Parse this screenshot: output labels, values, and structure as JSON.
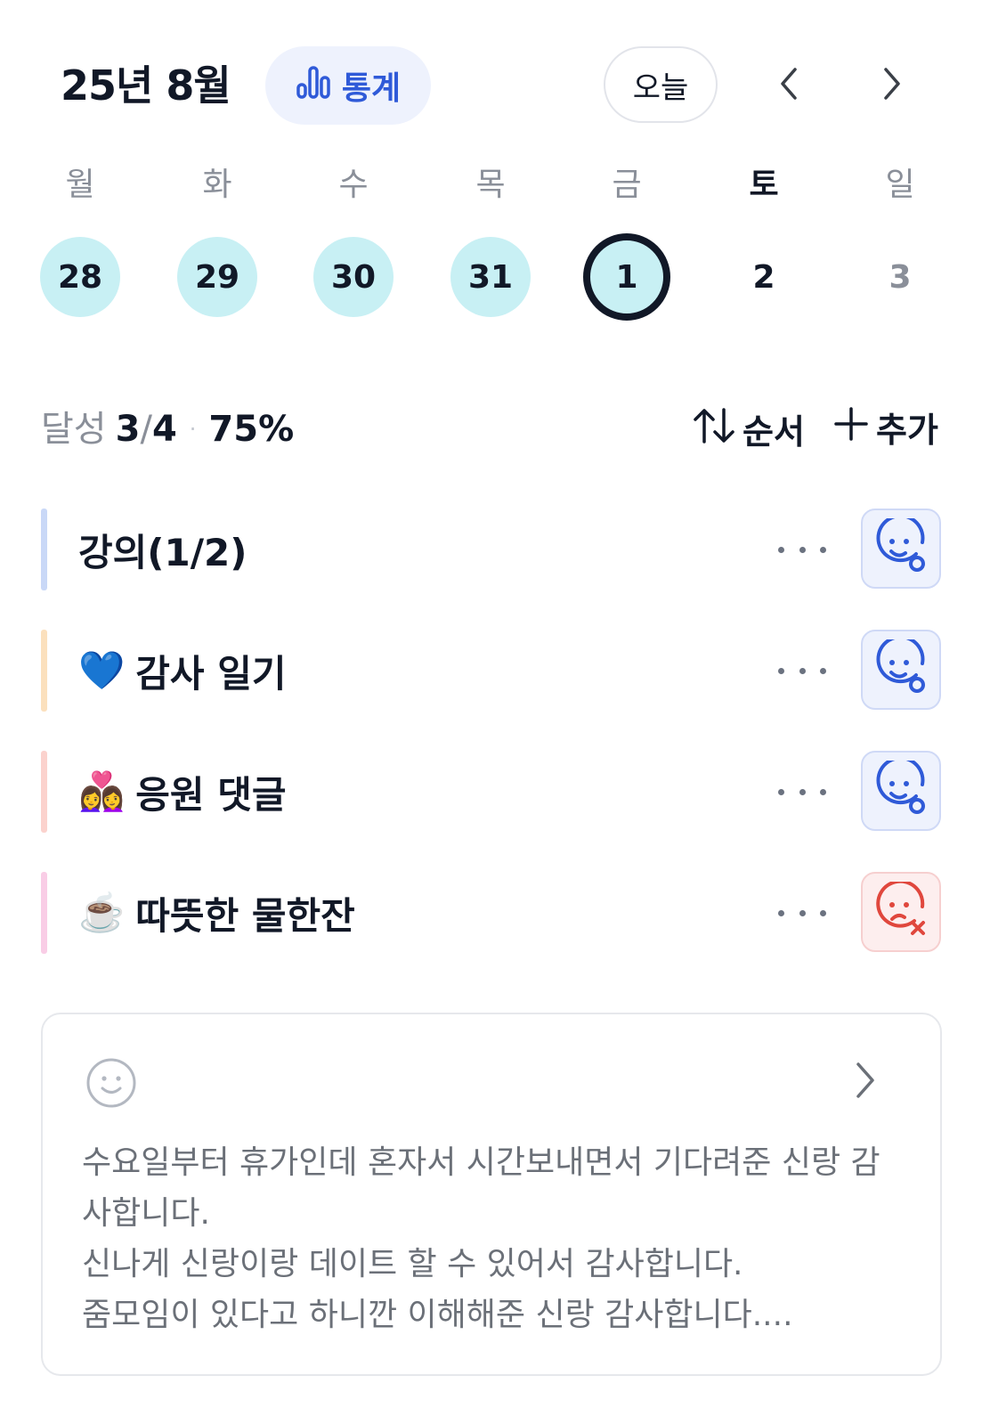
{
  "header": {
    "month": "25년 8월",
    "stats_label": "통계",
    "today_label": "오늘"
  },
  "week": {
    "days": [
      {
        "dow": "월",
        "date": "28",
        "state": "done"
      },
      {
        "dow": "화",
        "date": "29",
        "state": "done"
      },
      {
        "dow": "수",
        "date": "30",
        "state": "done"
      },
      {
        "dow": "목",
        "date": "31",
        "state": "done"
      },
      {
        "dow": "금",
        "date": "1",
        "state": "selected"
      },
      {
        "dow": "토",
        "date": "2",
        "state": "future"
      },
      {
        "dow": "일",
        "date": "3",
        "state": "future"
      }
    ]
  },
  "summary": {
    "label": "달성",
    "done": "3",
    "separator": "/",
    "total": "4",
    "dot": "·",
    "percent": "75%",
    "sort_label": "순서",
    "add_label": "추가"
  },
  "habits": [
    {
      "emoji": "",
      "name": "강의(1/2)",
      "bar_color": "#c9d8f7",
      "status": "ok"
    },
    {
      "emoji": "💙",
      "name": "감사 일기",
      "bar_color": "#fbe0bd",
      "status": "ok"
    },
    {
      "emoji": "👩‍❤️‍👩",
      "name": "응원 댓글",
      "bar_color": "#fbd2cd",
      "status": "ok"
    },
    {
      "emoji": "☕️",
      "name": "따뜻한 물한잔",
      "bar_color": "#f9cde6",
      "status": "fail"
    }
  ],
  "journal": {
    "lines": [
      "수요일부터 휴가인데 혼자서 시간보내면서 기다려준 신랑 감",
      "사합니다.",
      "신나게 신랑이랑 데이트 할 수 있어서 감사합니다.",
      "줌모임이 있다고 하니깐 이해해준 신랑 감사합니다...."
    ]
  },
  "colors": {
    "accent": "#2f5ad8",
    "done_circle": "#c8f0f4",
    "fail": "#e0473d"
  }
}
